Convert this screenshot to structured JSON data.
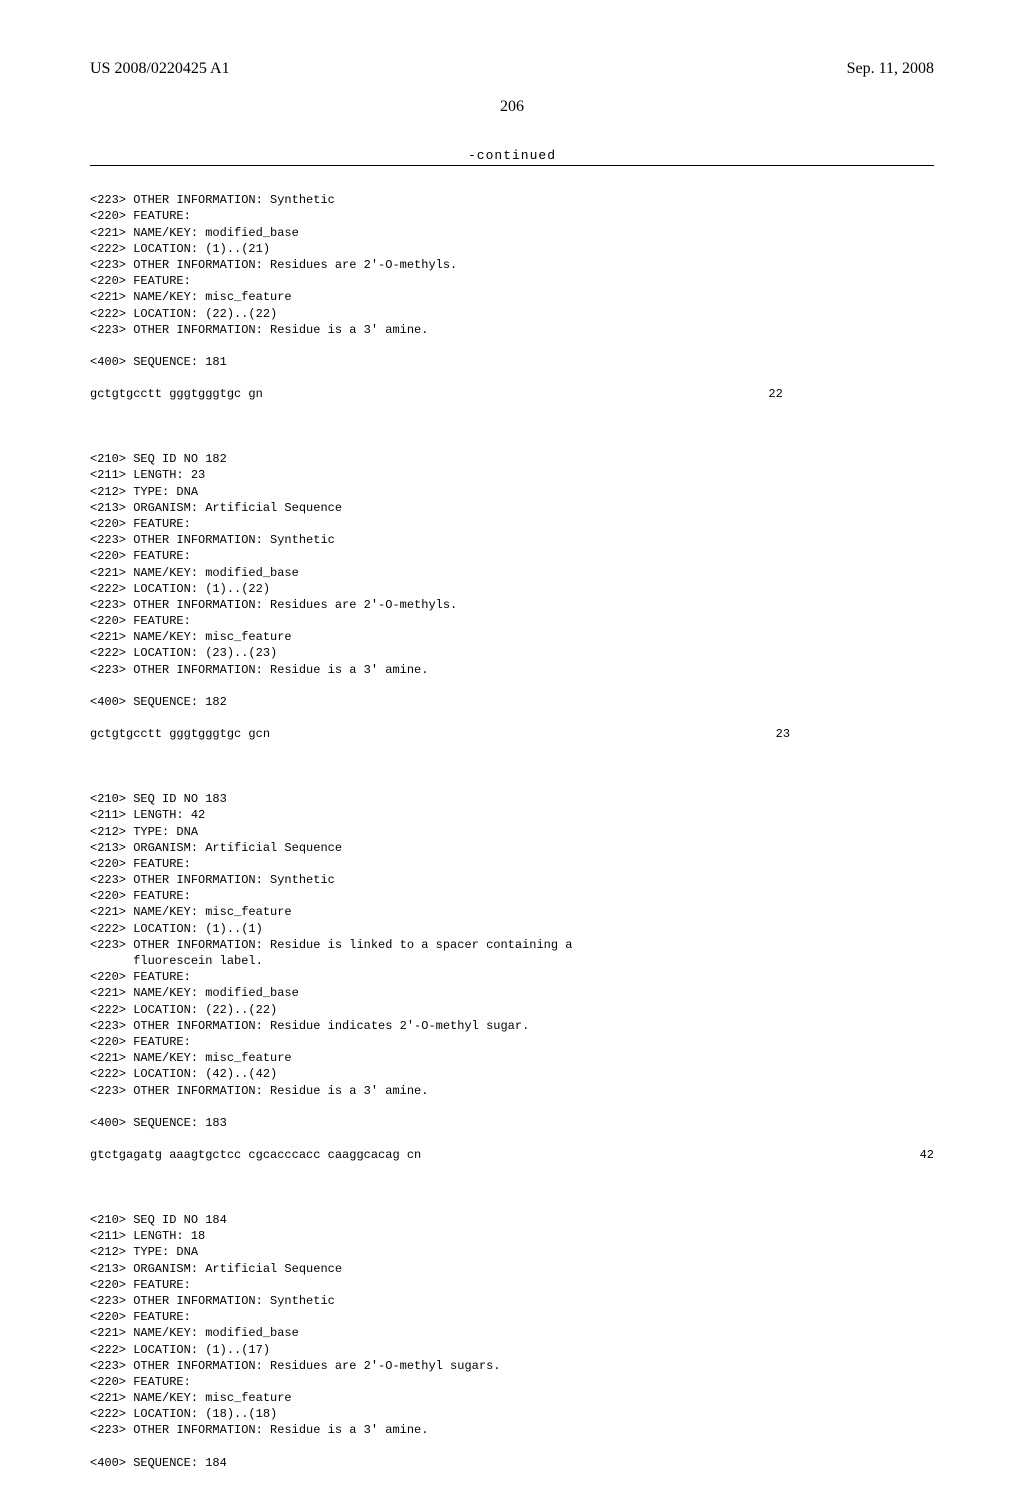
{
  "header": {
    "pub_number": "US 2008/0220425 A1",
    "pub_date": "Sep. 11, 2008"
  },
  "page_number": "206",
  "continued": "-continued",
  "blocks": {
    "b0": {
      "l1": "<223> OTHER INFORMATION: Synthetic",
      "l2": "<220> FEATURE:",
      "l3": "<221> NAME/KEY: modified_base",
      "l4": "<222> LOCATION: (1)..(21)",
      "l5": "<223> OTHER INFORMATION: Residues are 2'-O-methyls.",
      "l6": "<220> FEATURE:",
      "l7": "<221> NAME/KEY: misc_feature",
      "l8": "<222> LOCATION: (22)..(22)",
      "l9": "<223> OTHER INFORMATION: Residue is a 3' amine.",
      "sl": "<400> SEQUENCE: 181",
      "seq": "gctgtgcctt gggtgggtgc gn",
      "seqnum": "22"
    },
    "b1": {
      "l1": "<210> SEQ ID NO 182",
      "l2": "<211> LENGTH: 23",
      "l3": "<212> TYPE: DNA",
      "l4": "<213> ORGANISM: Artificial Sequence",
      "l5": "<220> FEATURE:",
      "l6": "<223> OTHER INFORMATION: Synthetic",
      "l7": "<220> FEATURE:",
      "l8": "<221> NAME/KEY: modified_base",
      "l9": "<222> LOCATION: (1)..(22)",
      "l10": "<223> OTHER INFORMATION: Residues are 2'-O-methyls.",
      "l11": "<220> FEATURE:",
      "l12": "<221> NAME/KEY: misc_feature",
      "l13": "<222> LOCATION: (23)..(23)",
      "l14": "<223> OTHER INFORMATION: Residue is a 3' amine.",
      "sl": "<400> SEQUENCE: 182",
      "seq": "gctgtgcctt gggtgggtgc gcn",
      "seqnum": "23"
    },
    "b2": {
      "l1": "<210> SEQ ID NO 183",
      "l2": "<211> LENGTH: 42",
      "l3": "<212> TYPE: DNA",
      "l4": "<213> ORGANISM: Artificial Sequence",
      "l5": "<220> FEATURE:",
      "l6": "<223> OTHER INFORMATION: Synthetic",
      "l7": "<220> FEATURE:",
      "l8": "<221> NAME/KEY: misc_feature",
      "l9": "<222> LOCATION: (1)..(1)",
      "l10": "<223> OTHER INFORMATION: Residue is linked to a spacer containing a",
      "l10b": "      fluorescein label.",
      "l11": "<220> FEATURE:",
      "l12": "<221> NAME/KEY: modified_base",
      "l13": "<222> LOCATION: (22)..(22)",
      "l14": "<223> OTHER INFORMATION: Residue indicates 2'-O-methyl sugar.",
      "l15": "<220> FEATURE:",
      "l16": "<221> NAME/KEY: misc_feature",
      "l17": "<222> LOCATION: (42)..(42)",
      "l18": "<223> OTHER INFORMATION: Residue is a 3' amine.",
      "sl": "<400> SEQUENCE: 183",
      "seq": "gtctgagatg aaagtgctcc cgcacccacc caaggcacag cn",
      "seqnum": "42"
    },
    "b3": {
      "l1": "<210> SEQ ID NO 184",
      "l2": "<211> LENGTH: 18",
      "l3": "<212> TYPE: DNA",
      "l4": "<213> ORGANISM: Artificial Sequence",
      "l5": "<220> FEATURE:",
      "l6": "<223> OTHER INFORMATION: Synthetic",
      "l7": "<220> FEATURE:",
      "l8": "<221> NAME/KEY: modified_base",
      "l9": "<222> LOCATION: (1)..(17)",
      "l10": "<223> OTHER INFORMATION: Residues are 2'-O-methyl sugars.",
      "l11": "<220> FEATURE:",
      "l12": "<221> NAME/KEY: misc_feature",
      "l13": "<222> LOCATION: (18)..(18)",
      "l14": "<223> OTHER INFORMATION: Residue is a 3' amine.",
      "sl": "<400> SEQUENCE: 184"
    }
  }
}
